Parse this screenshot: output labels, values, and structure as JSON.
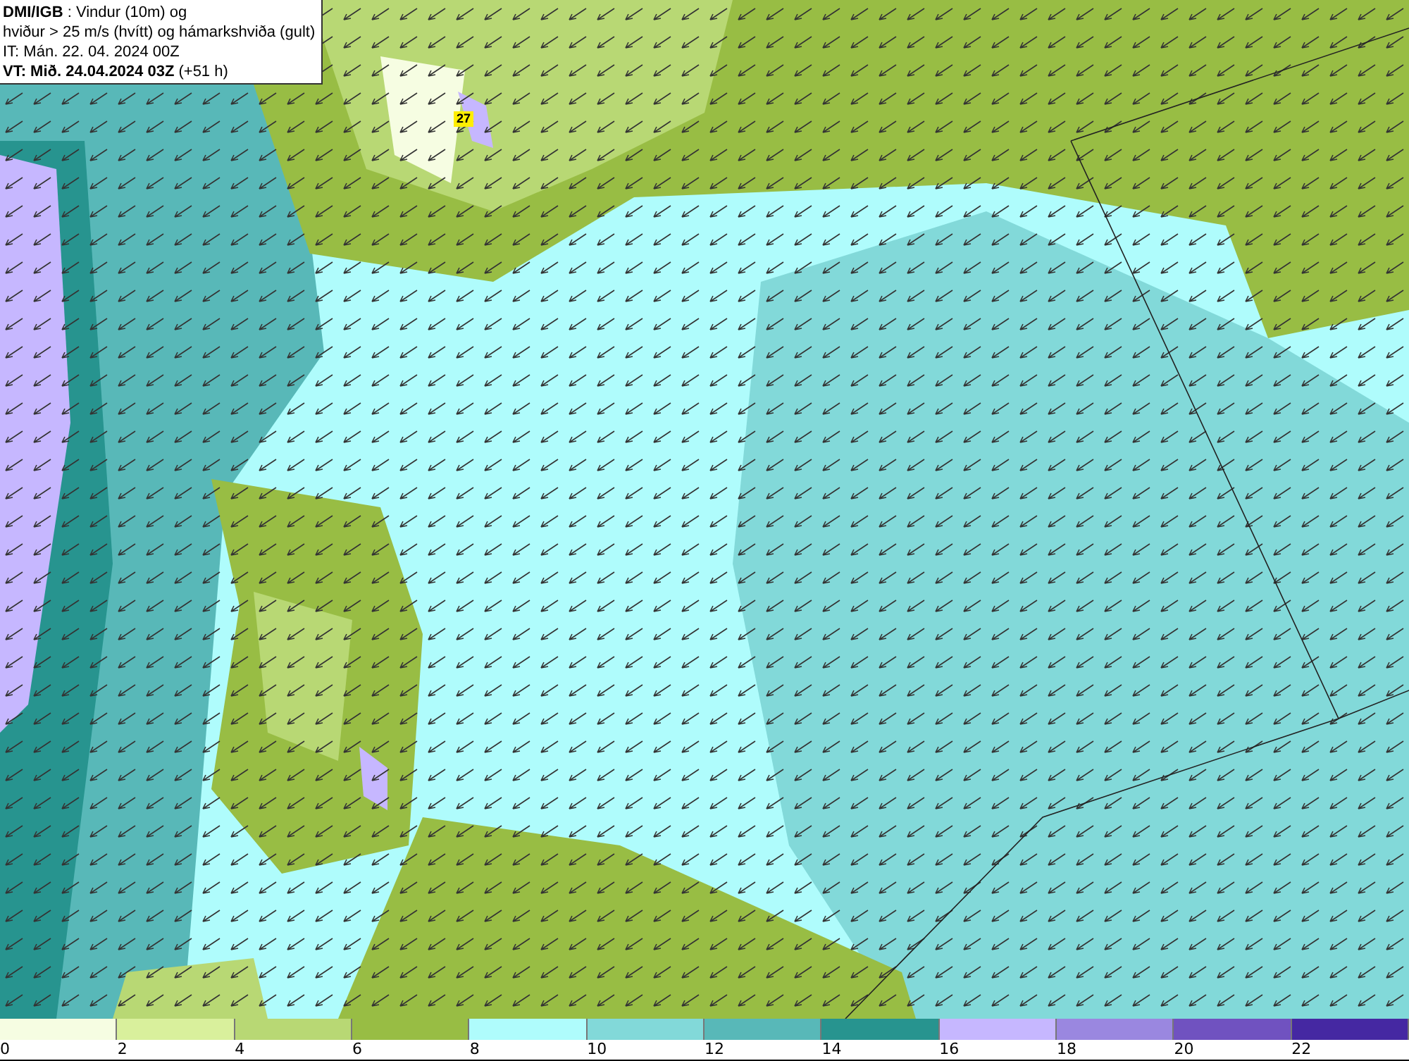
{
  "map": {
    "header": [
      "**DMI/IGB** : Vindur (10m) og",
      "hviður > 25 m/s (hvítt) og hámarkshviða (gult)",
      "IT: Mán. 22. 04. 2024 00Z",
      "**VT: Mið. 24.04.2024 03Z** (+51 h)"
    ],
    "max_gust_label": "27"
  },
  "legend": {
    "bins": [
      {
        "label": "0",
        "color": "#f6fde2"
      },
      {
        "label": "2",
        "color": "#d9f09c"
      },
      {
        "label": "4",
        "color": "#b8d874"
      },
      {
        "label": "6",
        "color": "#98bd44"
      },
      {
        "label": "8",
        "color": "#affcfc"
      },
      {
        "label": "10",
        "color": "#82d9d9"
      },
      {
        "label": "12",
        "color": "#58b8b8"
      },
      {
        "label": "14",
        "color": "#27948f"
      },
      {
        "label": "16",
        "color": "#c6b7ff"
      },
      {
        "label": "18",
        "color": "#9a87e0"
      },
      {
        "label": "20",
        "color": "#7052c0"
      },
      {
        "label": "22",
        "color": "#4528a2"
      }
    ]
  }
}
